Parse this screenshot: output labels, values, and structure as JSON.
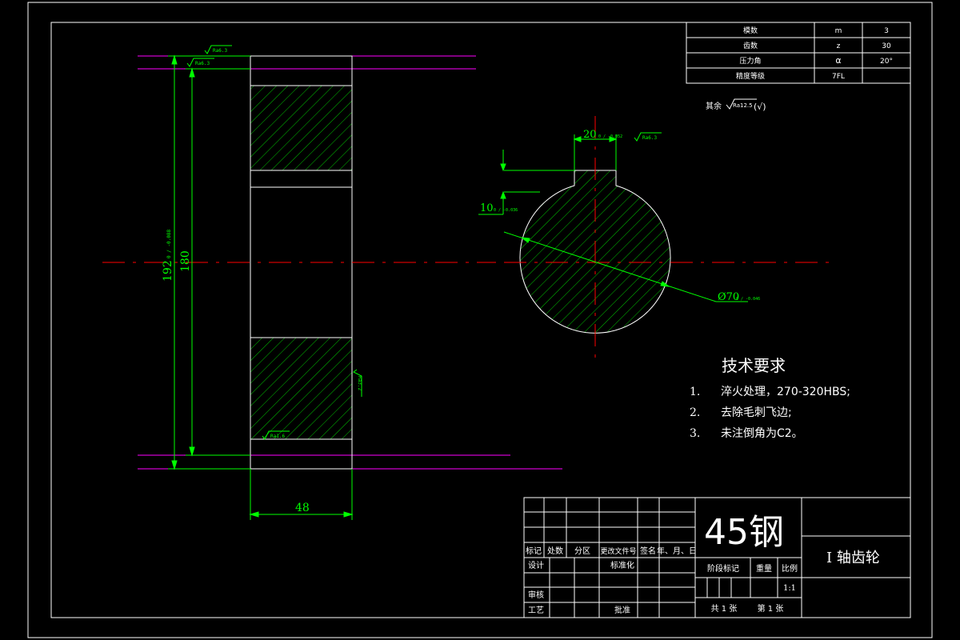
{
  "gear_params": {
    "rows": [
      {
        "label": "模数",
        "symbol": "m",
        "value": "3"
      },
      {
        "label": "齿数",
        "symbol": "z",
        "value": "30"
      },
      {
        "label": "压力角",
        "symbol": "α",
        "value": "20°"
      },
      {
        "label": "精度等级",
        "symbol": "7FL",
        "value": ""
      }
    ]
  },
  "roughness_other": {
    "label": "其余",
    "value": "Ra12.5",
    "suffix": "(√)"
  },
  "roughness_marks": {
    "top_face_1": "Ra6.3",
    "top_face_2": "Ra6.3",
    "bottom_face": "Ra1.6",
    "side_face": "Ra3.2",
    "keyway": "Ra6.3"
  },
  "dimensions": {
    "width": "48",
    "outer_dia": "192",
    "outer_tol": "0 / -0.088",
    "root_dia": "180",
    "key_width": "20",
    "key_tol": "0 / -0.052",
    "key_depth": "10",
    "key_depth_tol": "0 / -0.036",
    "bore_dia": "Ø70",
    "bore_tol": "0 / -0.046"
  },
  "tech_req": {
    "title": "技术要求",
    "items": [
      {
        "num": "1.",
        "text": "淬火处理，270-320HBS;"
      },
      {
        "num": "2.",
        "text": "去除毛刺飞边;"
      },
      {
        "num": "3.",
        "text": "未注倒角为C2。"
      }
    ]
  },
  "title_block": {
    "material": "45钢",
    "part_name": "I 轴齿轮",
    "col_labels": [
      "标记",
      "处数",
      "分区",
      "更改文件号",
      "签名",
      "年、月、日"
    ],
    "design": "设计",
    "standard": "标准化",
    "review": "审核",
    "process": "工艺",
    "approve": "批准",
    "stage_mark": "阶段标记",
    "weight": "重量",
    "scale_label": "比例",
    "scale": "1:1",
    "total_sheets": "共 1 张",
    "sheet_no": "第 1 张"
  },
  "colors": {
    "background": "#000000",
    "frame": "#ffffff",
    "dimension": "#00ff00",
    "centerline": "#ff0000",
    "phantom": "#ff00ff",
    "hatch": "#00c000"
  }
}
